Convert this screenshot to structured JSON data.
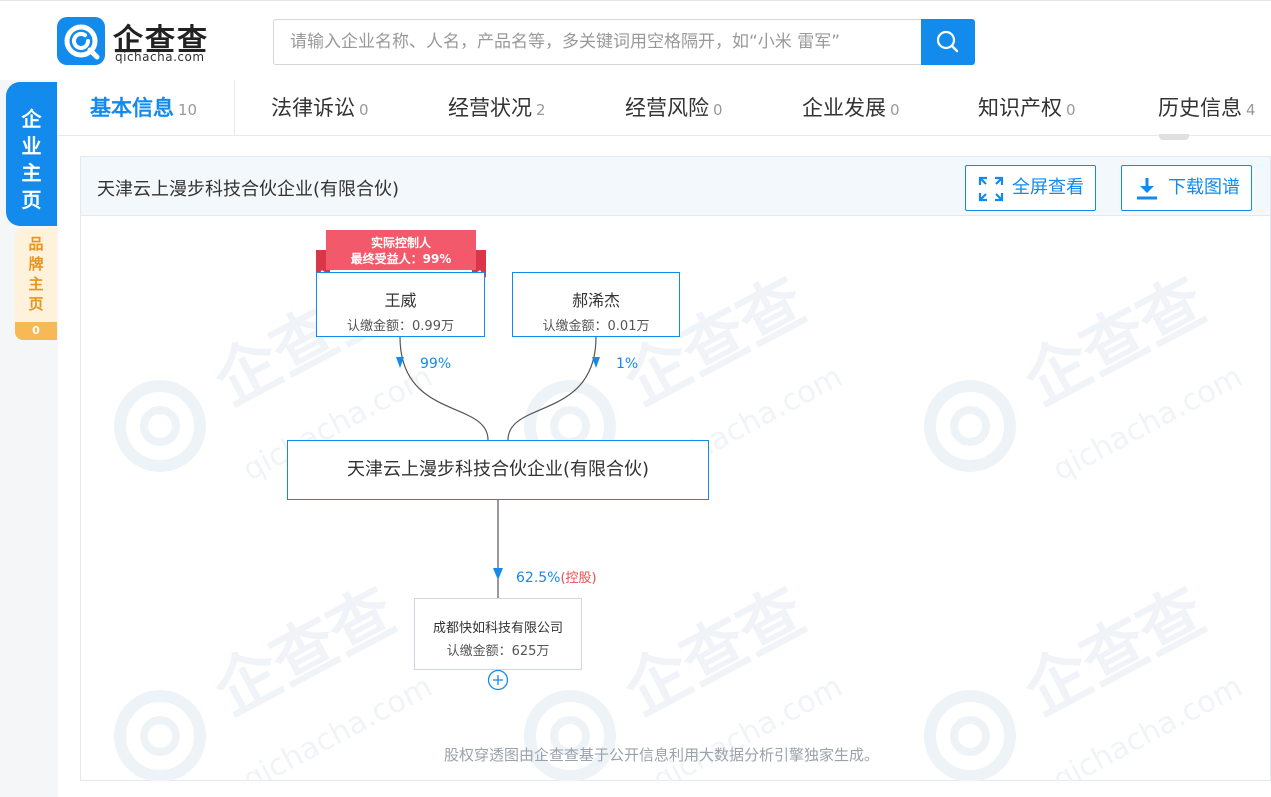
{
  "brand": {
    "name": "企查查",
    "domain": "qichacha.com",
    "color": "#128bed"
  },
  "search": {
    "placeholder": "请输入企业名称、人名，产品名等，多关键词用空格隔开，如“小米 雷军”"
  },
  "rail": {
    "main_label": "企业主页",
    "sub_label": "品牌主页",
    "sub_count": "0"
  },
  "tabs": [
    {
      "label": "基本信息",
      "count": "10",
      "active": true
    },
    {
      "label": "法律诉讼",
      "count": "0"
    },
    {
      "label": "经营状况",
      "count": "2"
    },
    {
      "label": "经营风险",
      "count": "0"
    },
    {
      "label": "企业发展",
      "count": "0"
    },
    {
      "label": "知识产权",
      "count": "0"
    },
    {
      "label": "历史信息",
      "count": "4"
    }
  ],
  "panel": {
    "title": "天津云上漫步科技合伙企业(有限合伙)",
    "fullscreen_label": "全屏查看",
    "download_label": "下载图谱"
  },
  "chart": {
    "badge_line1": "实际控制人",
    "badge_line2": "最终受益人：99%",
    "shareholders": [
      {
        "name": "王威",
        "amount": "认缴金额：0.99万",
        "percent": "99%"
      },
      {
        "name": "郝浠杰",
        "amount": "认缴金额：0.01万",
        "percent": "1%"
      }
    ],
    "center": {
      "name": "天津云上漫步科技合伙企业(有限合伙)"
    },
    "investment": {
      "percent": "62.5%",
      "tag": "(控股)"
    },
    "subsidiary": {
      "name": "成都快如科技有限公司",
      "amount": "认缴金额：625万"
    },
    "footnote": "股权穿透图由企查查基于公开信息利用大数据分析引擎独家生成。"
  }
}
